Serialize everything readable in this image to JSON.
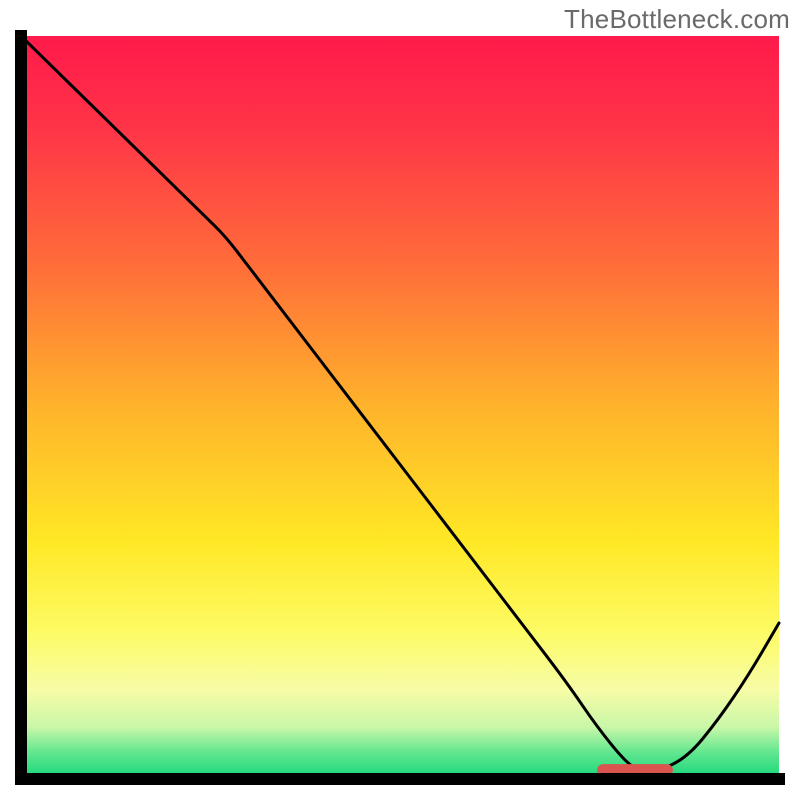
{
  "watermark": "TheBottleneck.com",
  "colors": {
    "curve": "#000000",
    "axis": "#000000",
    "marker": "#d9534f",
    "gradient_stops": [
      {
        "offset": 0.0,
        "color": "#ff1a4b"
      },
      {
        "offset": 0.12,
        "color": "#ff3348"
      },
      {
        "offset": 0.3,
        "color": "#ff6a3a"
      },
      {
        "offset": 0.5,
        "color": "#ffb32b"
      },
      {
        "offset": 0.68,
        "color": "#ffe825"
      },
      {
        "offset": 0.8,
        "color": "#fdfb63"
      },
      {
        "offset": 0.88,
        "color": "#f7fca6"
      },
      {
        "offset": 0.93,
        "color": "#c9f7a8"
      },
      {
        "offset": 0.965,
        "color": "#5fe68f"
      },
      {
        "offset": 1.0,
        "color": "#17d67a"
      }
    ]
  },
  "chart_data": {
    "type": "line",
    "title": "",
    "xlabel": "",
    "ylabel": "",
    "xlim": [
      0,
      100
    ],
    "ylim": [
      0,
      100
    ],
    "curve": {
      "x": [
        0,
        6,
        12,
        18,
        24,
        27,
        30,
        36,
        42,
        48,
        54,
        60,
        66,
        72,
        76,
        80,
        82,
        84,
        88,
        92,
        96,
        100
      ],
      "y": [
        100,
        94,
        88,
        82,
        76,
        73,
        69,
        61,
        53,
        45,
        37,
        29,
        21,
        13,
        7,
        2,
        1,
        1,
        3,
        8,
        14,
        21
      ]
    },
    "optimal_band": {
      "x_start": 76,
      "x_end": 86,
      "y": 1.2
    },
    "grid": false,
    "legend": false
  }
}
